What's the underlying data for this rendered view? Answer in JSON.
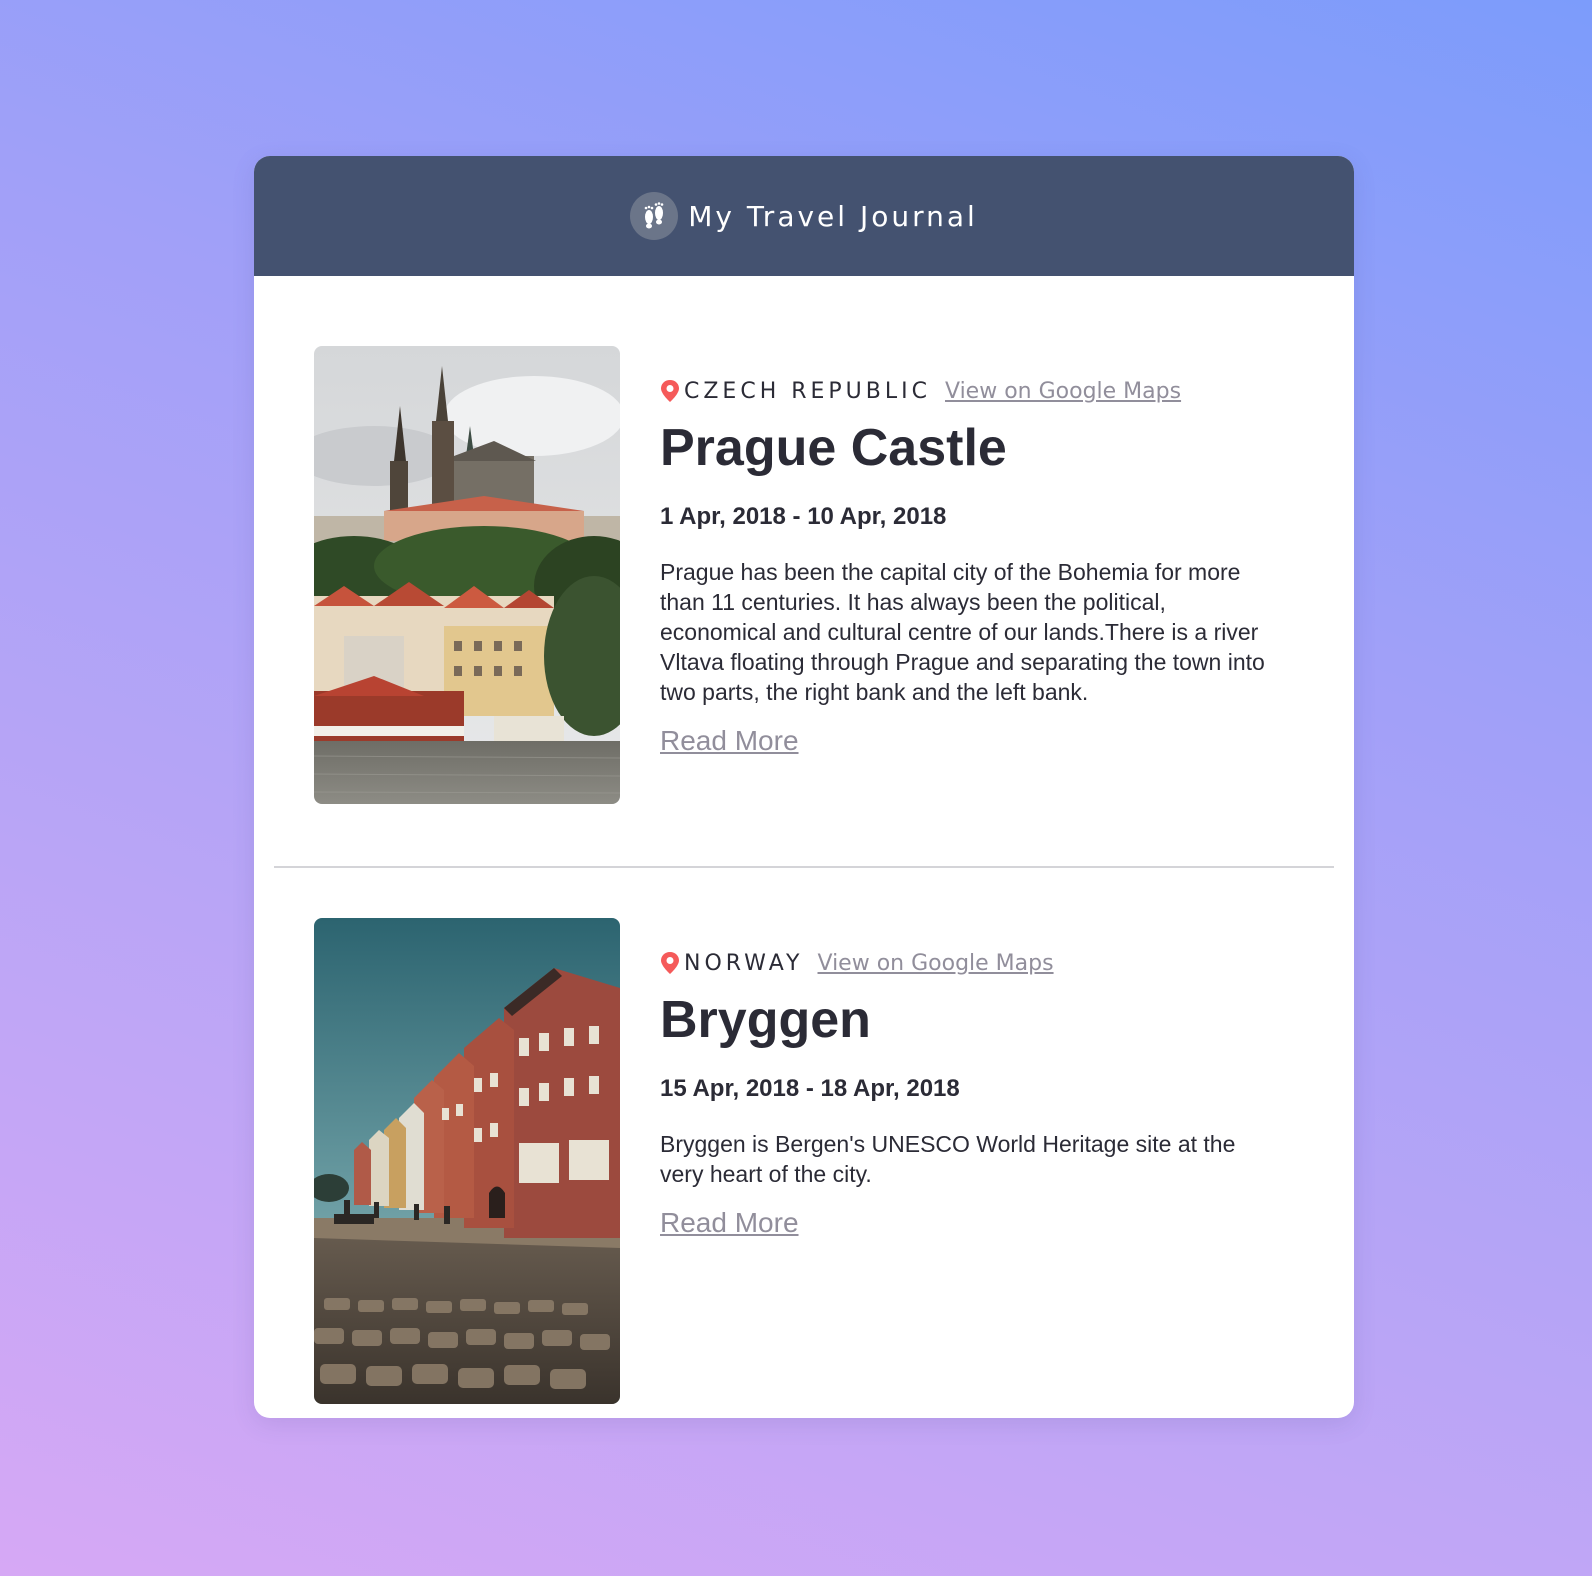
{
  "header": {
    "title": "My Travel Journal",
    "icon": "footprints-icon"
  },
  "entries": [
    {
      "country": "Czech Republic",
      "maps_link": "View on Google Maps",
      "title": "Prague Castle",
      "dates": "1 Apr, 2018 - 10 Apr, 2018",
      "description": "Prague has been the capital city of the Bohemia for more than 11 centuries. It has always been the political, economical and cultural centre of our lands.There is a river Vltava floating through Prague and separating the town into two parts, the right bank and the left bank.",
      "read_more": "Read More",
      "image": "prague-castle-photo"
    },
    {
      "country": "Norway",
      "maps_link": "View on Google Maps",
      "title": "Bryggen",
      "dates": "15 Apr, 2018 - 18 Apr, 2018",
      "description": "Bryggen is Bergen's UNESCO World Heritage site at the very heart of the city.",
      "read_more": "Read More",
      "image": "bryggen-photo"
    }
  ],
  "colors": {
    "header_bg": "#445270",
    "pin": "#f55a5a",
    "link": "#918e9b",
    "text": "#2b2b36"
  }
}
